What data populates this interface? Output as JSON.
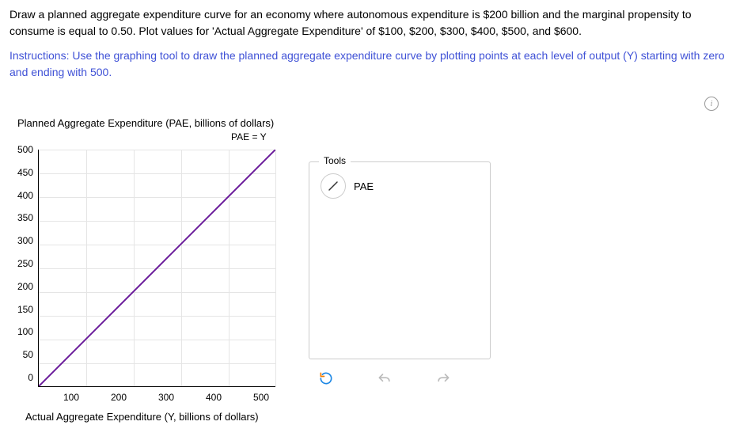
{
  "question": "Draw a planned aggregate expenditure curve for an economy where autonomous expenditure is $200 billion and the marginal propensity to consume is equal to 0.50. Plot values for 'Actual Aggregate Expenditure' of $100, $200, $300, $400, $500, and $600.",
  "instructions": {
    "label": "Instructions:",
    "body": "Use the graphing tool to draw the planned aggregate expenditure curve by plotting points at each level of output (Y) starting with zero and ending with 500."
  },
  "chart": {
    "y_title": "Planned Aggregate Expenditure (PAE, billions of dollars)",
    "x_title": "Actual Aggregate Expenditure (Y, billions of dollars)",
    "line_label": "PAE = Y",
    "y_ticks": [
      "500",
      "450",
      "400",
      "350",
      "300",
      "250",
      "200",
      "150",
      "100",
      "50",
      "0"
    ],
    "x_ticks": [
      "100",
      "200",
      "300",
      "400",
      "500"
    ]
  },
  "tools": {
    "title": "Tools",
    "pae_tool": "PAE"
  },
  "chart_data": {
    "type": "line",
    "title": "PAE = Y",
    "xlabel": "Actual Aggregate Expenditure (Y, billions of dollars)",
    "ylabel": "Planned Aggregate Expenditure (PAE, billions of dollars)",
    "xlim": [
      0,
      500
    ],
    "ylim": [
      0,
      500
    ],
    "series": [
      {
        "name": "PAE = Y",
        "x": [
          0,
          500
        ],
        "y": [
          0,
          500
        ],
        "color": "#6a1b9a"
      }
    ],
    "grid": true
  }
}
